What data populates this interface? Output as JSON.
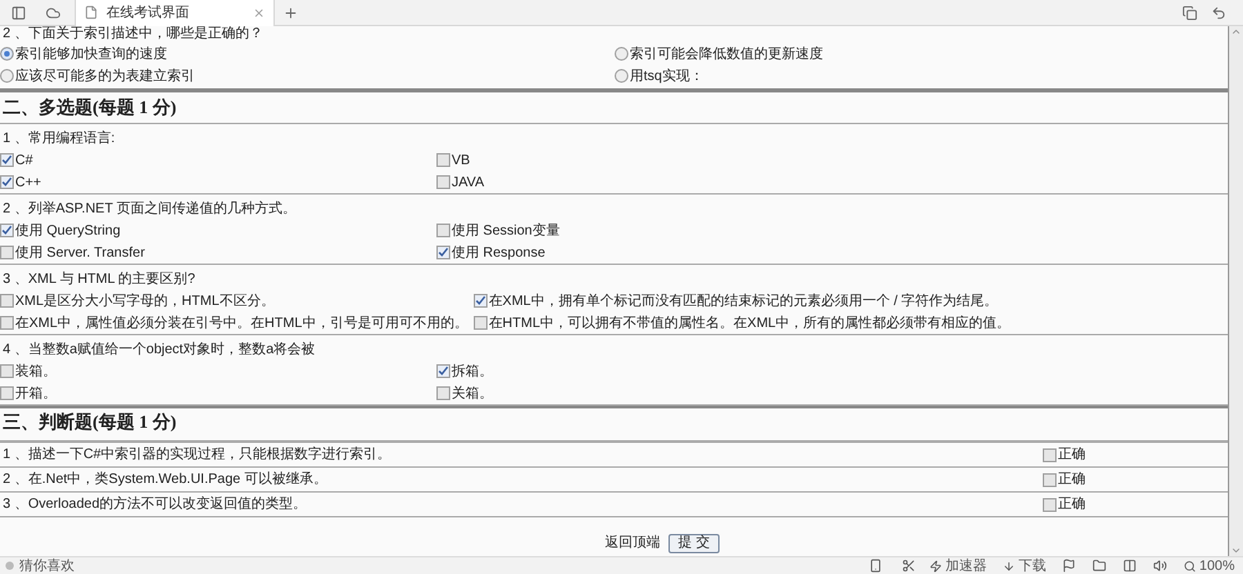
{
  "tab": {
    "title": "在线考试界面"
  },
  "single": {
    "question": "2 、下面关于索引描述中，哪些是正确的？",
    "options": [
      {
        "label": "索引能够加快查询的速度",
        "selected": true
      },
      {
        "label": "索引可能会降低数值的更新速度",
        "selected": false
      },
      {
        "label": "应该尽可能多的为表建立索引",
        "selected": false
      },
      {
        "label": "用tsq实现：",
        "selected": false
      }
    ]
  },
  "multi": {
    "title": "二、多选题(每题 1 分)",
    "questions": [
      {
        "text": "1 、常用编程语言:",
        "options": [
          {
            "label": "C#",
            "checked": true
          },
          {
            "label": "VB",
            "checked": false
          },
          {
            "label": "C++",
            "checked": true
          },
          {
            "label": "JAVA",
            "checked": false
          }
        ]
      },
      {
        "text": "2 、列举ASP.NET 页面之间传递值的几种方式。",
        "options": [
          {
            "label": "使用 QueryString",
            "checked": true
          },
          {
            "label": "使用 Session变量",
            "checked": false
          },
          {
            "label": "使用 Server. Transfer",
            "checked": false
          },
          {
            "label": "使用 Response",
            "checked": true
          }
        ]
      },
      {
        "text": "3 、XML 与 HTML 的主要区别?",
        "options": [
          {
            "label": "XML是区分大小写字母的，HTML不区分。",
            "checked": false
          },
          {
            "label": "在XML中，拥有单个标记而没有匹配的结束标记的元素必须用一个 / 字符作为结尾。",
            "checked": true
          },
          {
            "label": "在XML中，属性值必须分装在引号中。在HTML中，引号是可用可不用的。",
            "checked": false
          },
          {
            "label": "在HTML中，可以拥有不带值的属性名。在XML中，所有的属性都必须带有相应的值。",
            "checked": false
          }
        ]
      },
      {
        "text": "4 、当整数a赋值给一个object对象时，整数a将会被",
        "options": [
          {
            "label": "装箱。",
            "checked": false
          },
          {
            "label": "拆箱。",
            "checked": true
          },
          {
            "label": "开箱。",
            "checked": false
          },
          {
            "label": "关箱。",
            "checked": false
          }
        ]
      }
    ]
  },
  "judge": {
    "title": "三、判断题(每题 1 分)",
    "questions": [
      {
        "text": "1 、描述一下C#中索引器的实现过程，只能根据数字进行索引。",
        "option_label": "正确",
        "checked": false
      },
      {
        "text": "2 、在.Net中，类System.Web.UI.Page 可以被继承。",
        "option_label": "正确",
        "checked": false
      },
      {
        "text": "3 、Overloaded的方法不可以改变返回值的类型。",
        "option_label": "正确",
        "checked": false
      }
    ]
  },
  "footer": {
    "back_to_top": "返回顶端",
    "submit": "提 交"
  },
  "status_bar": {
    "left": "猜你喜欢",
    "items": [
      "加速器",
      "下载"
    ],
    "zoom": "100%"
  }
}
